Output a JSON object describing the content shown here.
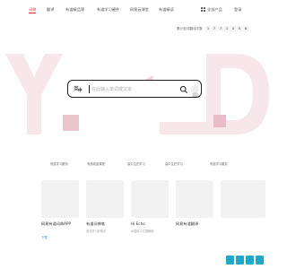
{
  "nav": {
    "items": [
      "词典",
      "翻译",
      "有道精品课",
      "有道学习硬件",
      "网易云课堂",
      "有道精读"
    ],
    "active_index": 0,
    "all_products": "全部产品",
    "login": "登录"
  },
  "counter": {
    "label": "累计查词翻译次数",
    "digits": [
      "1",
      "7",
      "7",
      "1",
      "4",
      "5",
      "6"
    ]
  },
  "search": {
    "lang_primary": "英",
    "lang_secondary": "中",
    "placeholder": "在此输入单词或文本"
  },
  "products": [
    {
      "label": "有道学习服务",
      "name": "网易有道词典APP",
      "desc": "",
      "link": "下载"
    },
    {
      "label": "有道精品课程",
      "name": "有道词典笔",
      "desc": "查词学习好帮手",
      "link": ""
    },
    {
      "label": "高中生在学习",
      "name": "Hi Echo",
      "desc": "AI虚拟人口语教练",
      "link": ""
    },
    {
      "label": "高中生在学习",
      "name": "",
      "desc": "",
      "link": ""
    },
    {
      "label": "有道学习服务",
      "name": "网易有道翻译",
      "desc": "",
      "link": ""
    },
    {
      "label": "有道学习服务",
      "name": "",
      "desc": "",
      "link": ""
    }
  ],
  "colors": {
    "accent": "#e33",
    "search_border": "#222",
    "card": "#f2f2f3",
    "link": "#4a8af4",
    "watermark": "#f6e3e8",
    "logo": "#1fa8c9"
  },
  "icons": [
    "grid-icon",
    "search-icon",
    "camera-icon",
    "logo-icon"
  ]
}
